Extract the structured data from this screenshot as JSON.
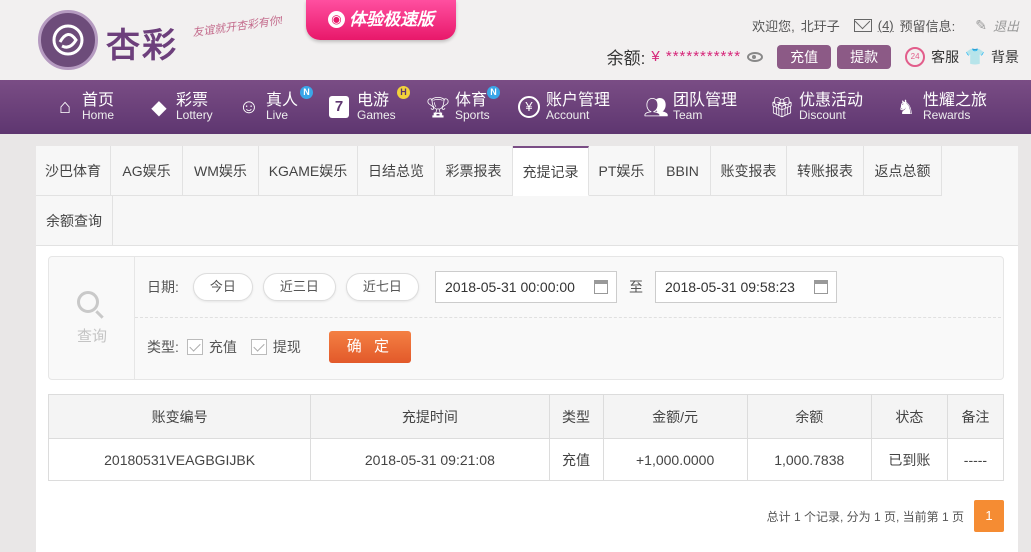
{
  "header": {
    "logo_text": "杏彩",
    "slogan": "友谊就开杏彩有你!",
    "promo": "体验极速版",
    "welcome": "欢迎您,",
    "username": "北玗子",
    "message_count": "(4)",
    "notice_label": "预留信息:",
    "logout": "退出",
    "balance_label": "余额:",
    "balance_value": "¥ ***********",
    "deposit": "充值",
    "withdraw": "提款",
    "service": "客服",
    "background": "背景"
  },
  "nav": {
    "items": [
      {
        "cn": "首页",
        "en": "Home",
        "icon": "home-icon",
        "badge": ""
      },
      {
        "cn": "彩票",
        "en": "Lottery",
        "icon": "lottery-icon",
        "badge": ""
      },
      {
        "cn": "真人",
        "en": "Live",
        "icon": "live-icon",
        "badge": "N"
      },
      {
        "cn": "电游",
        "en": "Games",
        "icon": "games-icon",
        "badge": "H"
      },
      {
        "cn": "体育",
        "en": "Sports",
        "icon": "trophy-icon",
        "badge": "N"
      },
      {
        "cn": "账户管理",
        "en": "Account",
        "icon": "account-icon",
        "badge": ""
      },
      {
        "cn": "团队管理",
        "en": "Team",
        "icon": "team-icon",
        "badge": ""
      },
      {
        "cn": "优惠活动",
        "en": "Discount",
        "icon": "gift-icon",
        "badge": ""
      },
      {
        "cn": "性耀之旅",
        "en": "Rewards",
        "icon": "rewards-icon",
        "badge": ""
      }
    ]
  },
  "tabs": [
    "沙巴体育",
    "AG娱乐",
    "WM娱乐",
    "KGAME娱乐",
    "日结总览",
    "彩票报表",
    "充提记录",
    "PT娱乐",
    "BBIN",
    "账变报表",
    "转账报表",
    "返点总额",
    "余额查询"
  ],
  "active_tab": "充提记录",
  "query": {
    "side_label": "查询",
    "date_label": "日期:",
    "quick": [
      "今日",
      "近三日",
      "近七日"
    ],
    "start": "2018-05-31 00:00:00",
    "to": "至",
    "end": "2018-05-31 09:58:23",
    "type_label": "类型:",
    "types": [
      "充值",
      "提现"
    ],
    "confirm": "确 定"
  },
  "table": {
    "headers": [
      "账变编号",
      "充提时间",
      "类型",
      "金额/元",
      "余额",
      "状态",
      "备注"
    ],
    "rows": [
      [
        "20180531VEAGBGIJBK",
        "2018-05-31 09:21:08",
        "充值",
        "+1,000.0000",
        "1,000.7838",
        "已到账",
        "-----"
      ]
    ]
  },
  "pager": {
    "info": "总计 1 个记录, 分为 1 页, 当前第 1 页",
    "current": "1"
  },
  "colors": {
    "brand": "#6d3f7c",
    "nav": "#7a4d85",
    "accent": "#f58c33",
    "pink": "#e8186a"
  }
}
